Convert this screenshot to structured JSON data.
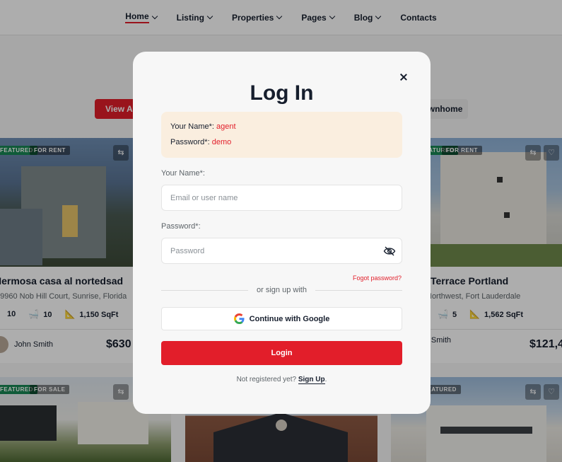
{
  "nav": {
    "items": [
      {
        "label": "Home",
        "active": true
      },
      {
        "label": "Listing"
      },
      {
        "label": "Properties"
      },
      {
        "label": "Pages"
      },
      {
        "label": "Blog"
      },
      {
        "label": "Contacts"
      }
    ]
  },
  "filters": {
    "view_all": "View All",
    "tab_right": "Townhome"
  },
  "cards": [
    {
      "badges": [
        "FEATURED",
        "FOR RENT"
      ],
      "title": "Hermosa casa al nortedsad",
      "address": "59960 Nob Hill Court, Sunrise, Florida",
      "beds": "10",
      "baths": "10",
      "area": "1,150 SqFt",
      "agent": "John Smith",
      "price": "$630"
    },
    {
      "badges": [
        "FEATURED",
        "FOR RENT"
      ],
      "title": "Terrace Portland",
      "address": "Northwest, Fort Lauderdale",
      "beds": "",
      "baths": "5",
      "area": "1,562 SqFt",
      "agent": "John Smith",
      "price": "$121,4"
    },
    {
      "badges": [
        "FEATURED",
        "FOR SALE"
      ]
    },
    {
      "badges": [
        "FEATURED"
      ]
    }
  ],
  "modal": {
    "title": "Log In",
    "demo": {
      "name_label": "Your Name*:",
      "name_value": "agent",
      "pass_label": "Password*:",
      "pass_value": "demo"
    },
    "name_label": "Your Name*:",
    "name_placeholder": "Email or user name",
    "password_label": "Password*:",
    "password_placeholder": "Password",
    "forgot": "Fogot password?",
    "or_text": "or sign up with",
    "google_label": "Continue with Google",
    "login_label": "Login",
    "signup_prefix": "Not registered yet?",
    "signup_link": "Sign Up",
    "signup_suffix": "."
  },
  "colors": {
    "accent": "#e21e2a",
    "demo_bg": "#faeedf",
    "modal_bg": "#f7f7f7"
  },
  "icons": [
    "chevron-down-icon",
    "close-icon",
    "google-icon",
    "eye-off-icon",
    "compare-icon",
    "heart-icon",
    "bed-icon",
    "bath-icon",
    "ruler-icon"
  ]
}
